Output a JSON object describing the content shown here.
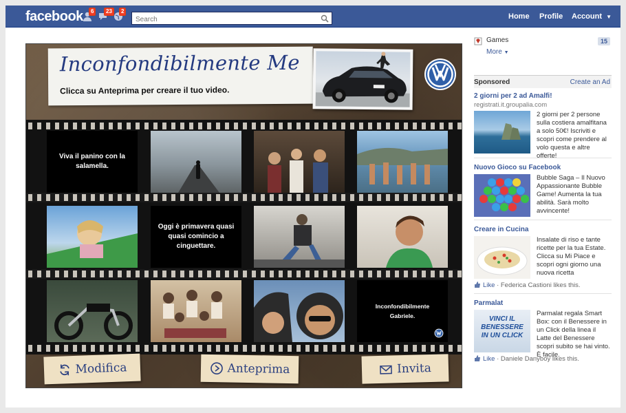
{
  "topbar": {
    "logo": "facebook",
    "badges": {
      "friend_requests": "6",
      "messages": "23",
      "notifications": "2"
    },
    "search_placeholder": "Search",
    "nav": {
      "home": "Home",
      "profile": "Profile",
      "account": "Account"
    },
    "colors": {
      "bar": "#3b5998",
      "badge": "#f03d25"
    }
  },
  "app": {
    "title": "Inconfondibilmente Me",
    "subtitle": "Clicca su Anteprima per creare il tuo video.",
    "captions": {
      "c1": "Viva il panino con la salamella.",
      "c2": "Oggi è primavera quasi quasi comincio a cinguettare.",
      "c3": "Inconfondibilmente Gabriele."
    },
    "buttons": {
      "edit": "Modifica",
      "preview": "Anteprima",
      "invite": "Invita"
    }
  },
  "sidebar": {
    "games_label": "Games",
    "games_count": "15",
    "more_label": "More",
    "sponsored_label": "Sponsored",
    "create_ad_label": "Create an Ad",
    "ads": [
      {
        "title": "2 giorni per 2 ad Amalfi!",
        "url": "registrati.it.groupalia.com",
        "body": "2 giorni per 2 persone sulla costiera amalfitana a solo 50€! Iscriviti e scopri come prendere al volo questa e altre offerte!"
      },
      {
        "title": "Nuovo Gioco su Facebook",
        "body": "Bubble Saga – Il Nuovo Appassionante Bubble Game! Aumenta la tua abilità. Sarà molto avvincente!"
      },
      {
        "title": "Creare in Cucina",
        "body": "Insalate di riso e tante ricette per la tua Estate. Clicca su Mi Piace e scopri ogni giorno una nuova ricetta",
        "like_label": "Like",
        "like_text": " · Federica Castioni likes this."
      },
      {
        "title": "Parmalat",
        "image_text": "VINCI IL BENESSERE IN UN CLICK",
        "body": "Parmalat regala Smart Box: con il Benessere in un Click della linea il Latte del Benessere scopri subito se hai vinto. È facile.",
        "like_label": "Like",
        "like_text": " · Daniele Danyboy likes this."
      }
    ]
  }
}
